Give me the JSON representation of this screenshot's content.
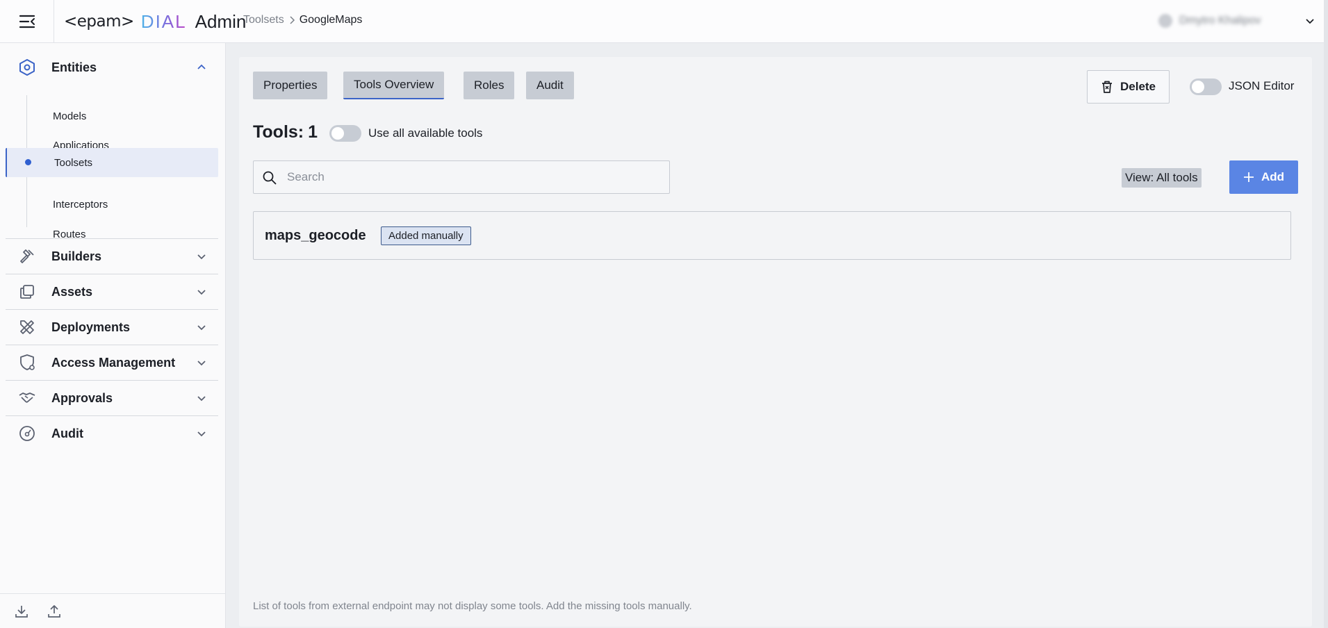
{
  "header": {
    "logo": {
      "epam": "<epam>",
      "dial": "DIAL",
      "admin": "Admin"
    },
    "breadcrumb": {
      "parent": "Toolsets",
      "current": "GoogleMaps"
    },
    "user": {
      "name": "Dmytro Khalipov"
    }
  },
  "sidebar": {
    "sections": {
      "entities": "Entities",
      "builders": "Builders",
      "assets": "Assets",
      "deployments": "Deployments",
      "access_management": "Access Management",
      "approvals": "Approvals",
      "audit": "Audit"
    },
    "entities_items": {
      "models": "Models",
      "applications": "Applications",
      "toolsets": "Toolsets",
      "interceptors": "Interceptors",
      "routes": "Routes"
    },
    "active_item": "Toolsets"
  },
  "tabs": {
    "properties": "Properties",
    "tools_overview": "Tools Overview",
    "roles": "Roles",
    "audit": "Audit",
    "active": "Tools Overview"
  },
  "toolbar": {
    "delete_label": "Delete",
    "json_editor_label": "JSON Editor",
    "json_editor_on": false
  },
  "tools": {
    "title_prefix": "Tools:",
    "count": "1",
    "use_all_label": "Use all available tools",
    "use_all_on": false,
    "search_placeholder": "Search",
    "search_value": "",
    "view_label": "View: All tools",
    "add_label": "Add",
    "items": [
      {
        "name": "maps_geocode",
        "badge": "Added manually"
      }
    ],
    "footnote": "List of tools from external endpoint may not display some tools. Add the missing tools manually."
  },
  "colors": {
    "accent": "#3b63c7",
    "primary_button": "#5a85e4",
    "tab_bg": "#c7ccd4",
    "panel_bg": "#f3f4f6"
  },
  "icons": {
    "menu": "menu-collapse-icon",
    "entities": "hexagon-icon",
    "builders": "hammer-icon",
    "assets": "copy-icon",
    "deployments": "tools-icon",
    "access_management": "shield-gear-icon",
    "approvals": "handshake-icon",
    "audit": "gauge-icon",
    "download": "download-icon",
    "upload": "upload-icon",
    "delete": "trash-icon",
    "search": "search-icon",
    "add": "plus-icon"
  }
}
